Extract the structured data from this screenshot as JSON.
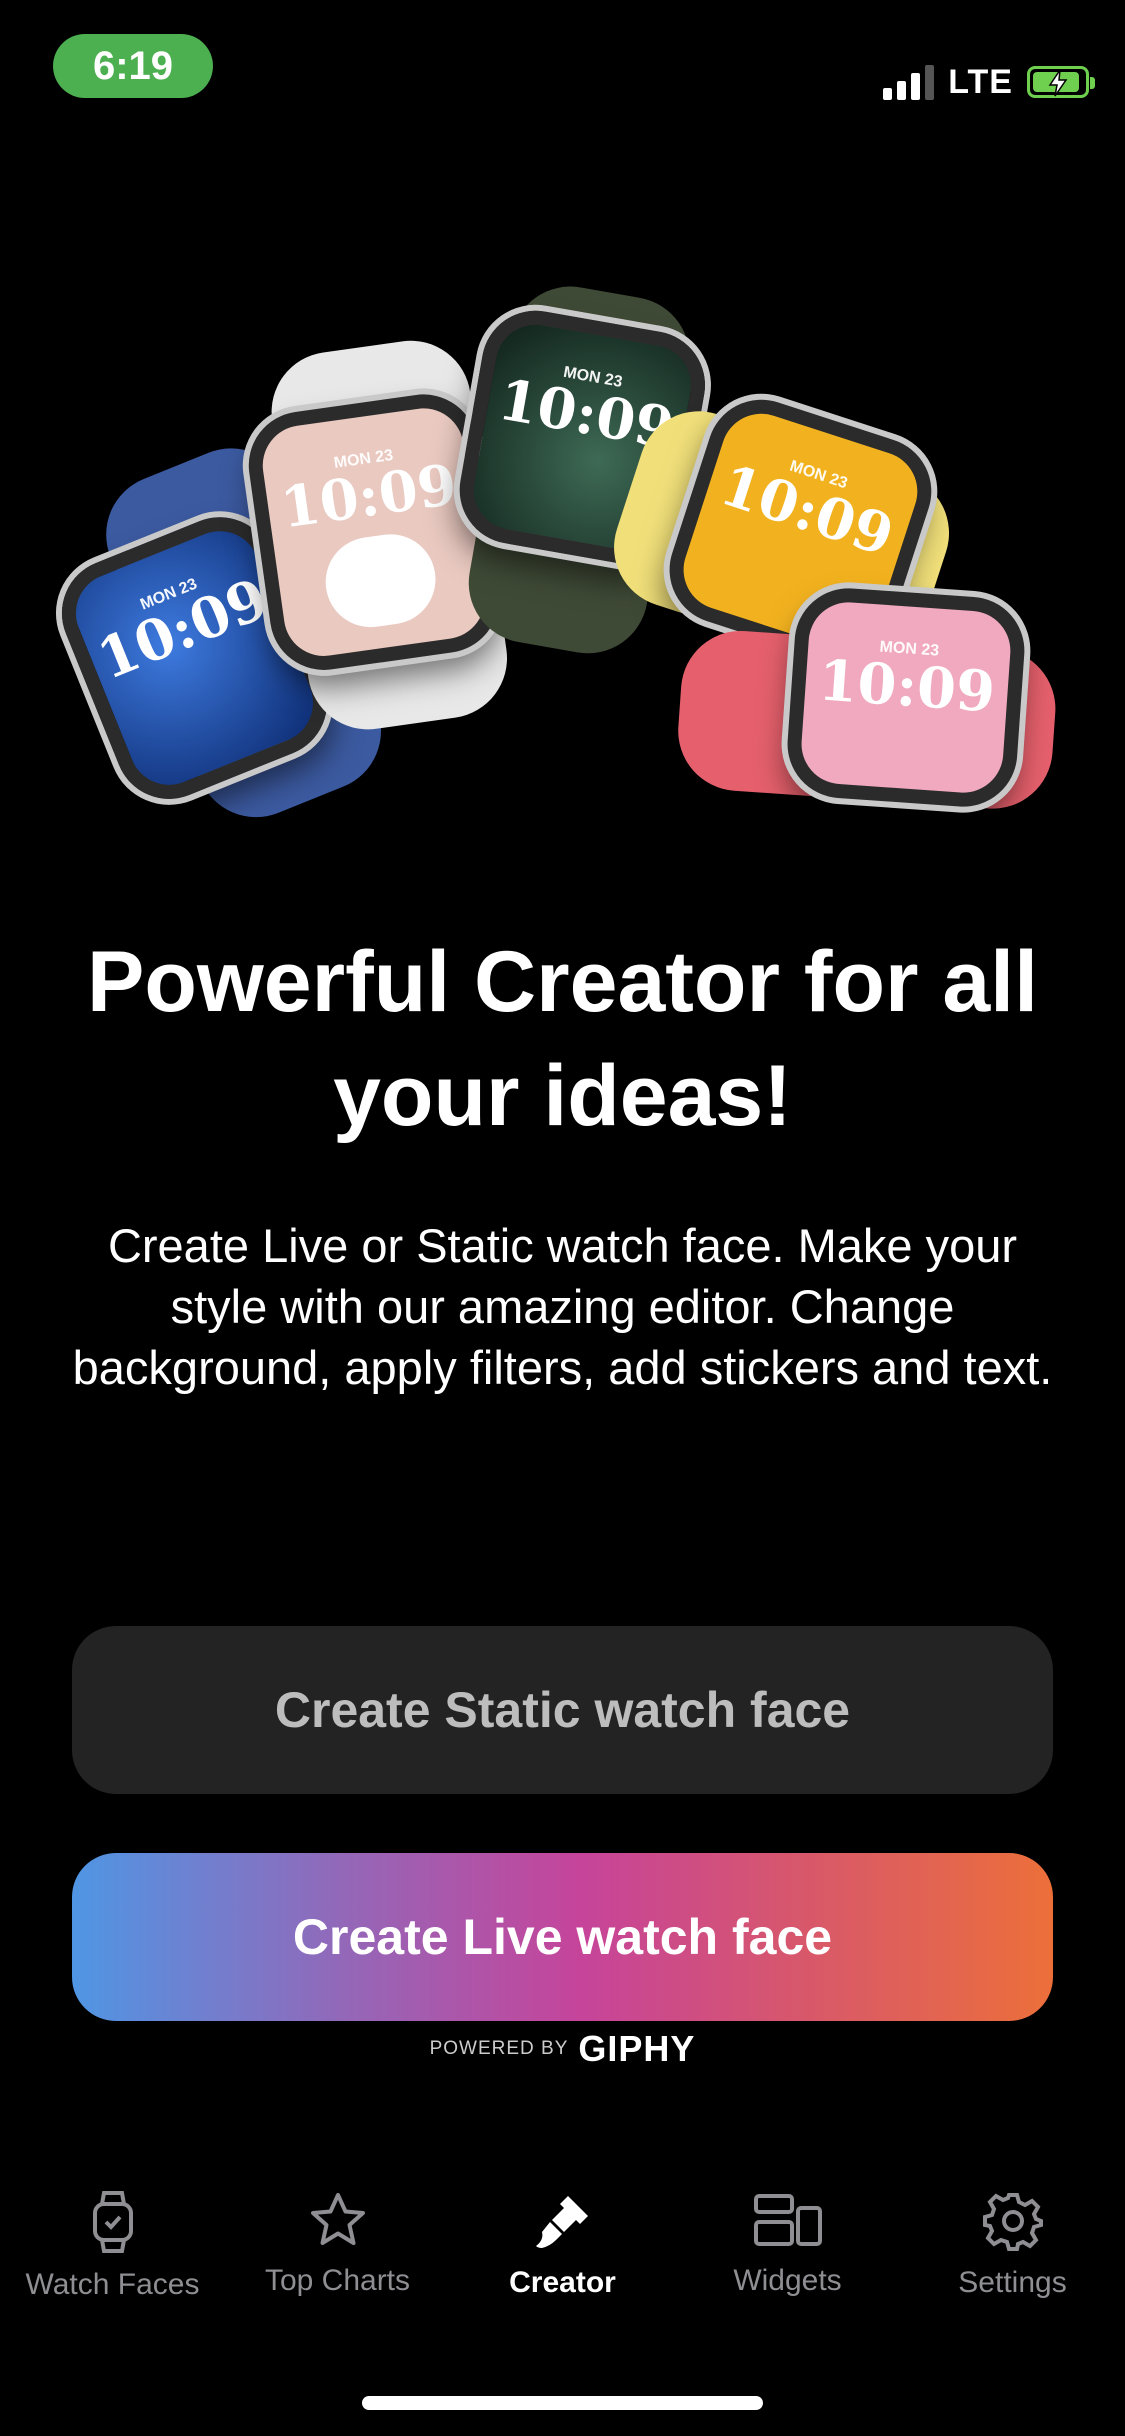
{
  "status_bar": {
    "time": "6:19",
    "network": "LTE",
    "signal_bars_filled": 3,
    "signal_bars_total": 4,
    "battery_state": "charging",
    "time_pill_color": "#4caf50",
    "battery_color": "#6fcf4f"
  },
  "hero": {
    "watches": [
      {
        "date": "MON 23",
        "time": "10:09",
        "face_color": "#1f4ca8",
        "band_color": "#3c5aa0"
      },
      {
        "date": "MON 23",
        "time": "10:09",
        "face_color": "#e9c9c0",
        "band_color": "#e8e8e8"
      },
      {
        "date": "MON 23",
        "time": "10:09",
        "face_color": "#2f4a3c",
        "band_color": "#3f4a36"
      },
      {
        "date": "MON 23",
        "time": "10:09",
        "face_color": "#f2b21f",
        "band_color": "#f1e07a"
      },
      {
        "date": "MON 23",
        "time": "10:09",
        "face_color": "#f0a9bf",
        "band_color": "#e5606c"
      }
    ]
  },
  "main": {
    "headline": "Powerful Creator for all your ideas!",
    "description": "Create Live or Static watch face. Make your style with our amazing editor. Change background, apply filters, add stickers and text.",
    "static_button_label": "Create Static watch face",
    "live_button_label": "Create Live watch face",
    "powered_label": "POWERED BY",
    "powered_brand": "GIPHY"
  },
  "tabbar": {
    "items": [
      {
        "label": "Watch Faces",
        "icon": "watch-icon",
        "active": false
      },
      {
        "label": "Top Charts",
        "icon": "star-icon",
        "active": false
      },
      {
        "label": "Creator",
        "icon": "brush-icon",
        "active": true
      },
      {
        "label": "Widgets",
        "icon": "widgets-icon",
        "active": false
      },
      {
        "label": "Settings",
        "icon": "gear-icon",
        "active": false
      }
    ]
  },
  "colors": {
    "background": "#000000",
    "static_button_bg": "#232323",
    "live_gradient": [
      "#4f96e4",
      "#9467b8",
      "#c6449a",
      "#d8586a",
      "#ec6f3a"
    ],
    "tab_inactive": "#8e8e93",
    "tab_active": "#ffffff"
  }
}
